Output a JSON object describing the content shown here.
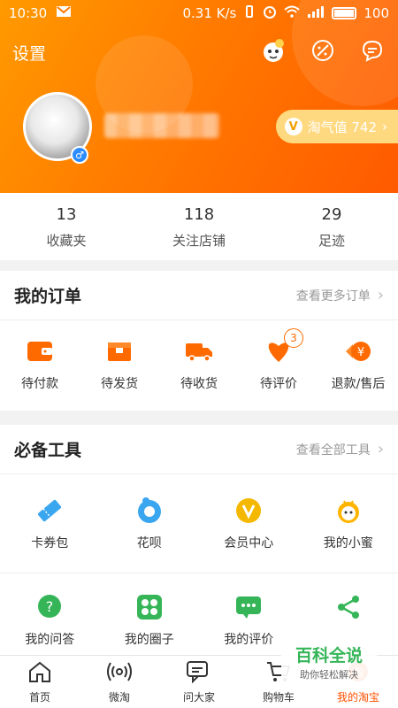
{
  "status_bar": {
    "time": "10:30",
    "speed": "0.31 K/s",
    "battery": "100"
  },
  "header": {
    "settings_label": "设置",
    "taoqi_label": "淘气值 742",
    "taoqi_badge": "V",
    "gender_symbol": "♂"
  },
  "stats": [
    {
      "num": "13",
      "label": "收藏夹"
    },
    {
      "num": "118",
      "label": "关注店铺"
    },
    {
      "num": "29",
      "label": "足迹"
    }
  ],
  "orders": {
    "title": "我的订单",
    "more": "查看更多订单",
    "items": [
      {
        "label": "待付款",
        "icon": "wallet-icon"
      },
      {
        "label": "待发货",
        "icon": "box-icon"
      },
      {
        "label": "待收货",
        "icon": "truck-icon"
      },
      {
        "label": "待评价",
        "icon": "review-icon",
        "badge": "3"
      },
      {
        "label": "退款/售后",
        "icon": "refund-icon"
      }
    ]
  },
  "tools": {
    "title": "必备工具",
    "more": "查看全部工具",
    "row1": [
      {
        "label": "卡券包",
        "icon": "ticket-icon"
      },
      {
        "label": "花呗",
        "icon": "huabei-icon"
      },
      {
        "label": "会员中心",
        "icon": "vip-icon"
      },
      {
        "label": "我的小蜜",
        "icon": "bee-icon"
      }
    ],
    "row2": [
      {
        "label": "我的问答",
        "icon": "question-icon"
      },
      {
        "label": "我的圈子",
        "icon": "circle-icon"
      },
      {
        "label": "我的评价",
        "icon": "comment-icon"
      },
      {
        "label": "",
        "icon": "share-icon"
      }
    ]
  },
  "tabbar": [
    {
      "label": "首页",
      "icon": "home-icon"
    },
    {
      "label": "微淘",
      "icon": "broadcast-icon"
    },
    {
      "label": "问大家",
      "icon": "chat-icon"
    },
    {
      "label": "购物车",
      "icon": "cart-icon"
    },
    {
      "label": "我的淘宝",
      "icon": "taobao-icon",
      "active": true
    }
  ],
  "watermark": {
    "title": "百科全说",
    "subtitle": "助你轻松解决"
  },
  "colors": {
    "accent": "#ff5000",
    "header_orange": "#ff7a00",
    "green": "#35b558"
  }
}
